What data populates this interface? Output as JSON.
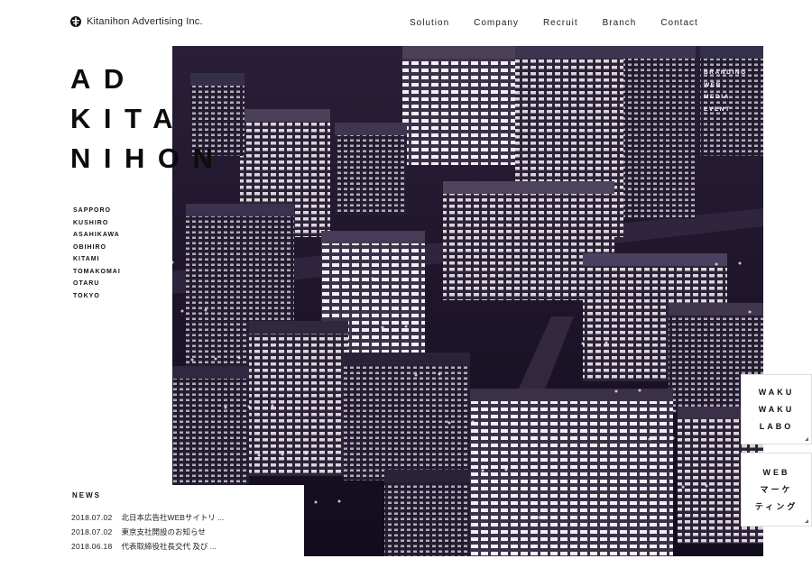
{
  "header": {
    "logo_text": "Kitanihon Advertising Inc.",
    "logo_icon": "kitanihon-logo-mark",
    "nav": [
      "Solution",
      "Company",
      "Recruit",
      "Branch",
      "Contact"
    ]
  },
  "hero": {
    "title_lines": [
      "AD",
      "KITA",
      "NIHON"
    ],
    "services": [
      "BRANDING",
      "WEB",
      "MEDIA",
      "EVENT"
    ],
    "image": "night-city-aerial-photo"
  },
  "cities": [
    "SAPPORO",
    "KUSHIRO",
    "ASAHIKAWA",
    "OBIHIRO",
    "KITAMI",
    "TOMAKOMAI",
    "OTARU",
    "TOKYO"
  ],
  "side_boxes": [
    {
      "lines": [
        "WAKU",
        "WAKU",
        "LABO"
      ]
    },
    {
      "lines": [
        "WEB",
        "マーケ",
        "ティング"
      ]
    }
  ],
  "news": {
    "title": "NEWS",
    "items": [
      {
        "date": "2018.07.02",
        "text": "北日本広告社WEBサイトリ ..."
      },
      {
        "date": "2018.07.02",
        "text": "東京支社開設のお知らせ"
      },
      {
        "date": "2018.06.18",
        "text": "代表取締役社長交代 及び ..."
      }
    ]
  },
  "colors": {
    "hero_dark": "#1c1428",
    "window_light": "#f2e6f2",
    "text": "#111111"
  }
}
